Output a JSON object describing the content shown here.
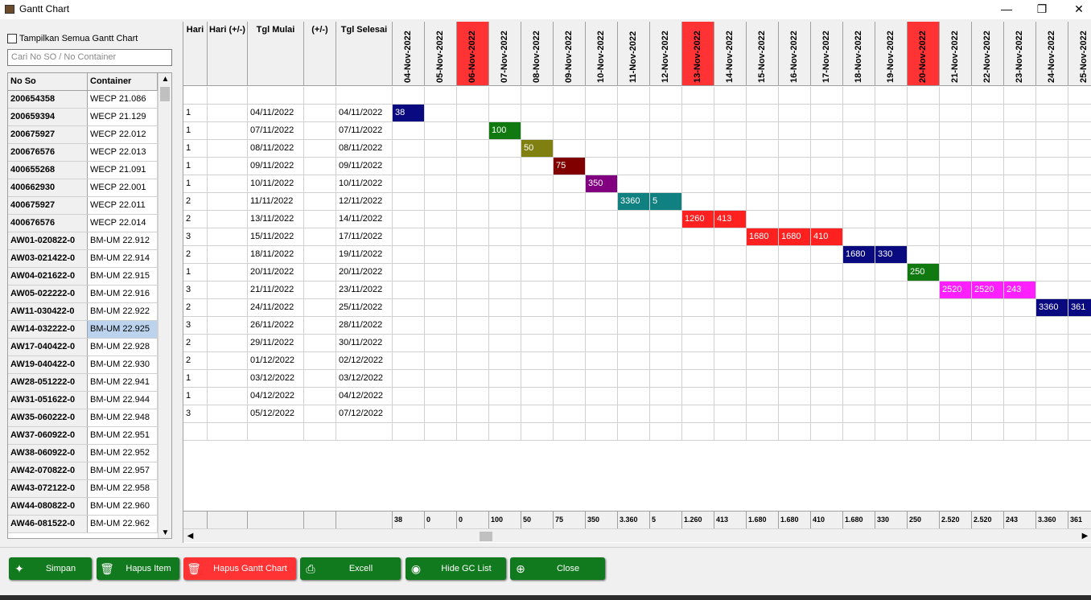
{
  "window": {
    "title": "Gantt Chart",
    "minimize": "—",
    "maximize": "❐",
    "close": "✕"
  },
  "left": {
    "show_all_label": "Tampilkan Semua Gantt Chart",
    "search_placeholder": "Cari No SO / No Container",
    "col_so": "No So",
    "col_container": "Container",
    "rows": [
      [
        "200654358",
        "WECP 21.086"
      ],
      [
        "200659394",
        "WECP 21.129"
      ],
      [
        "200675927",
        "WECP 22.012"
      ],
      [
        "200676576",
        "WECP 22.013"
      ],
      [
        "400655268",
        "WECP 21.091"
      ],
      [
        "400662930",
        "WECP 22.001"
      ],
      [
        "400675927",
        "WECP 22.011"
      ],
      [
        "400676576",
        "WECP 22.014"
      ],
      [
        "AW01-020822-0",
        "BM-UM 22.912"
      ],
      [
        "AW03-021422-0",
        "BM-UM 22.914"
      ],
      [
        "AW04-021622-0",
        "BM-UM 22.915"
      ],
      [
        "AW05-022222-0",
        "BM-UM 22.916"
      ],
      [
        "AW11-030422-0",
        "BM-UM 22.922"
      ],
      [
        "AW14-032222-0",
        "BM-UM 22.925"
      ],
      [
        "AW17-040422-0",
        "BM-UM 22.928"
      ],
      [
        "AW19-040422-0",
        "BM-UM 22.930"
      ],
      [
        "AW28-051222-0",
        "BM-UM 22.941"
      ],
      [
        "AW31-051622-0",
        "BM-UM 22.944"
      ],
      [
        "AW35-060222-0",
        "BM-UM 22.948"
      ],
      [
        "AW37-060922-0",
        "BM-UM 22.951"
      ],
      [
        "AW38-060922-0",
        "BM-UM 22.952"
      ],
      [
        "AW42-070822-0",
        "BM-UM 22.957"
      ],
      [
        "AW43-072122-0",
        "BM-UM 22.958"
      ],
      [
        "AW44-080822-0",
        "BM-UM 22.960"
      ],
      [
        "AW46-081522-0",
        "BM-UM 22.962"
      ]
    ],
    "selected_index": 13
  },
  "grid": {
    "headers": {
      "hari": "Hari",
      "hari_pm": "Hari (+/-)",
      "tgl_mulai": "Tgl Mulai",
      "pm": "(+/-)",
      "tgl_selesai": "Tgl Selesai"
    },
    "dates": [
      "04-Nov-2022",
      "05-Nov-2022",
      "06-Nov-2022",
      "07-Nov-2022",
      "08-Nov-2022",
      "09-Nov-2022",
      "10-Nov-2022",
      "11-Nov-2022",
      "12-Nov-2022",
      "13-Nov-2022",
      "14-Nov-2022",
      "15-Nov-2022",
      "16-Nov-2022",
      "17-Nov-2022",
      "18-Nov-2022",
      "19-Nov-2022",
      "20-Nov-2022",
      "21-Nov-2022",
      "22-Nov-2022",
      "23-Nov-2022",
      "24-Nov-2022",
      "25-Nov-2022"
    ],
    "red_dates": [
      2,
      9,
      16
    ],
    "rows": [
      {
        "hari": "1",
        "mulai": "04/11/2022",
        "selesai": "04/11/2022",
        "bars": [
          [
            0,
            "38"
          ]
        ],
        "color": "#0a0a80"
      },
      {
        "hari": "1",
        "mulai": "07/11/2022",
        "selesai": "07/11/2022",
        "bars": [
          [
            3,
            "100"
          ]
        ],
        "color": "#107a10"
      },
      {
        "hari": "1",
        "mulai": "08/11/2022",
        "selesai": "08/11/2022",
        "bars": [
          [
            4,
            "50"
          ]
        ],
        "color": "#808010"
      },
      {
        "hari": "1",
        "mulai": "09/11/2022",
        "selesai": "09/11/2022",
        "bars": [
          [
            5,
            "75"
          ]
        ],
        "color": "#800000"
      },
      {
        "hari": "1",
        "mulai": "10/11/2022",
        "selesai": "10/11/2022",
        "bars": [
          [
            6,
            "350"
          ]
        ],
        "color": "#800080"
      },
      {
        "hari": "2",
        "mulai": "11/11/2022",
        "selesai": "12/11/2022",
        "bars": [
          [
            7,
            "3360"
          ],
          [
            8,
            "5"
          ]
        ],
        "color": "#108080"
      },
      {
        "hari": "2",
        "mulai": "13/11/2022",
        "selesai": "14/11/2022",
        "bars": [
          [
            9,
            "1260"
          ],
          [
            10,
            "413"
          ]
        ],
        "color": "#ff2020"
      },
      {
        "hari": "3",
        "mulai": "15/11/2022",
        "selesai": "17/11/2022",
        "bars": [
          [
            11,
            "1680"
          ],
          [
            12,
            "1680"
          ],
          [
            13,
            "410"
          ]
        ],
        "color": "#ff2020"
      },
      {
        "hari": "2",
        "mulai": "18/11/2022",
        "selesai": "19/11/2022",
        "bars": [
          [
            14,
            "1680"
          ],
          [
            15,
            "330"
          ]
        ],
        "color": "#0a0a80"
      },
      {
        "hari": "1",
        "mulai": "20/11/2022",
        "selesai": "20/11/2022",
        "bars": [
          [
            16,
            "250"
          ]
        ],
        "color": "#107a10"
      },
      {
        "hari": "3",
        "mulai": "21/11/2022",
        "selesai": "23/11/2022",
        "bars": [
          [
            17,
            "2520"
          ],
          [
            18,
            "2520"
          ],
          [
            19,
            "243"
          ]
        ],
        "color": "#ff20ff"
      },
      {
        "hari": "2",
        "mulai": "24/11/2022",
        "selesai": "25/11/2022",
        "bars": [
          [
            20,
            "3360"
          ],
          [
            21,
            "361"
          ]
        ],
        "color": "#0a0a80"
      },
      {
        "hari": "3",
        "mulai": "26/11/2022",
        "selesai": "28/11/2022",
        "bars": [],
        "color": ""
      },
      {
        "hari": "2",
        "mulai": "29/11/2022",
        "selesai": "30/11/2022",
        "bars": [],
        "color": ""
      },
      {
        "hari": "2",
        "mulai": "01/12/2022",
        "selesai": "02/12/2022",
        "bars": [],
        "color": ""
      },
      {
        "hari": "1",
        "mulai": "03/12/2022",
        "selesai": "03/12/2022",
        "bars": [],
        "color": ""
      },
      {
        "hari": "1",
        "mulai": "04/12/2022",
        "selesai": "04/12/2022",
        "bars": [],
        "color": ""
      },
      {
        "hari": "3",
        "mulai": "05/12/2022",
        "selesai": "07/12/2022",
        "bars": [],
        "color": ""
      }
    ],
    "totals": [
      "38",
      "0",
      "0",
      "100",
      "50",
      "75",
      "350",
      "3.360",
      "5",
      "1.260",
      "413",
      "1.680",
      "1.680",
      "410",
      "1.680",
      "330",
      "250",
      "2.520",
      "2.520",
      "243",
      "3.360",
      "361"
    ]
  },
  "buttons": {
    "simpan": "Simpan",
    "hapus_item": "Hapus Item",
    "hapus_gantt": "Hapus Gantt Chart",
    "excel": "Excell",
    "hide_gc": "Hide GC List",
    "close": "Close"
  }
}
